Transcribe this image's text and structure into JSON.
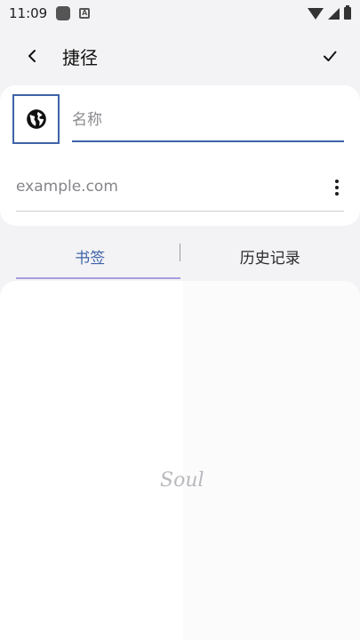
{
  "status_bar": {
    "time": "11:09",
    "icons": [
      "app-icon",
      "a-icon",
      "wifi-icon",
      "signal-icon",
      "battery-icon"
    ]
  },
  "app_bar": {
    "title": "捷径",
    "back_icon": "chevron-left-icon",
    "confirm_icon": "check-icon"
  },
  "form": {
    "icon_button": "globe-icon",
    "name_placeholder": "名称",
    "url_placeholder": "example.com",
    "more_icon": "more-vertical-icon"
  },
  "tabs": [
    {
      "label": "书签",
      "selected": true
    },
    {
      "label": "历史记录",
      "selected": false
    }
  ],
  "content": {
    "watermark": "Soul"
  },
  "colors": {
    "accent": "#3e63a8",
    "indicator": "#a99de0",
    "background": "#f3f3f5"
  }
}
